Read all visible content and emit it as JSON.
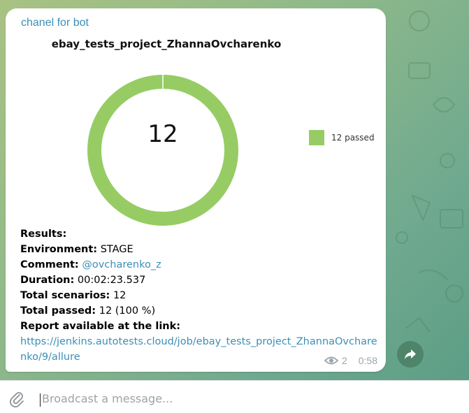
{
  "channel": {
    "name": "chanel for bot"
  },
  "chart_data": {
    "type": "pie",
    "title": "ebay_tests_project_ZhannaOvcharenko",
    "center_label": "12",
    "slices": [
      {
        "label": "12 passed",
        "value": 12,
        "color": "#97cc64"
      }
    ],
    "legend_position": "right"
  },
  "message": {
    "results_label": "Results:",
    "environment_label": "Environment:",
    "environment_value": "STAGE",
    "comment_label": "Comment:",
    "comment_value": "@ovcharenko_z",
    "duration_label": "Duration:",
    "duration_value": "00:02:23.537",
    "total_scenarios_label": "Total scenarios:",
    "total_scenarios_value": "12",
    "total_passed_label": "Total passed:",
    "total_passed_value": "12 (100 %)",
    "report_label": "Report available at the link:",
    "report_url": "https://jenkins.autotests.cloud/job/ebay_tests_project_ZhannaOvcharenko/9/allure"
  },
  "meta": {
    "views": "2",
    "time": "0:58",
    "views_icon": "eye-icon"
  },
  "actions": {
    "forward_icon": "forward-icon"
  },
  "composer": {
    "placeholder": "Broadcast a message...",
    "attach_icon": "paperclip-icon"
  },
  "colors": {
    "accent": "#3a8fb7",
    "pass": "#97cc64",
    "background": "#8fb98a"
  }
}
